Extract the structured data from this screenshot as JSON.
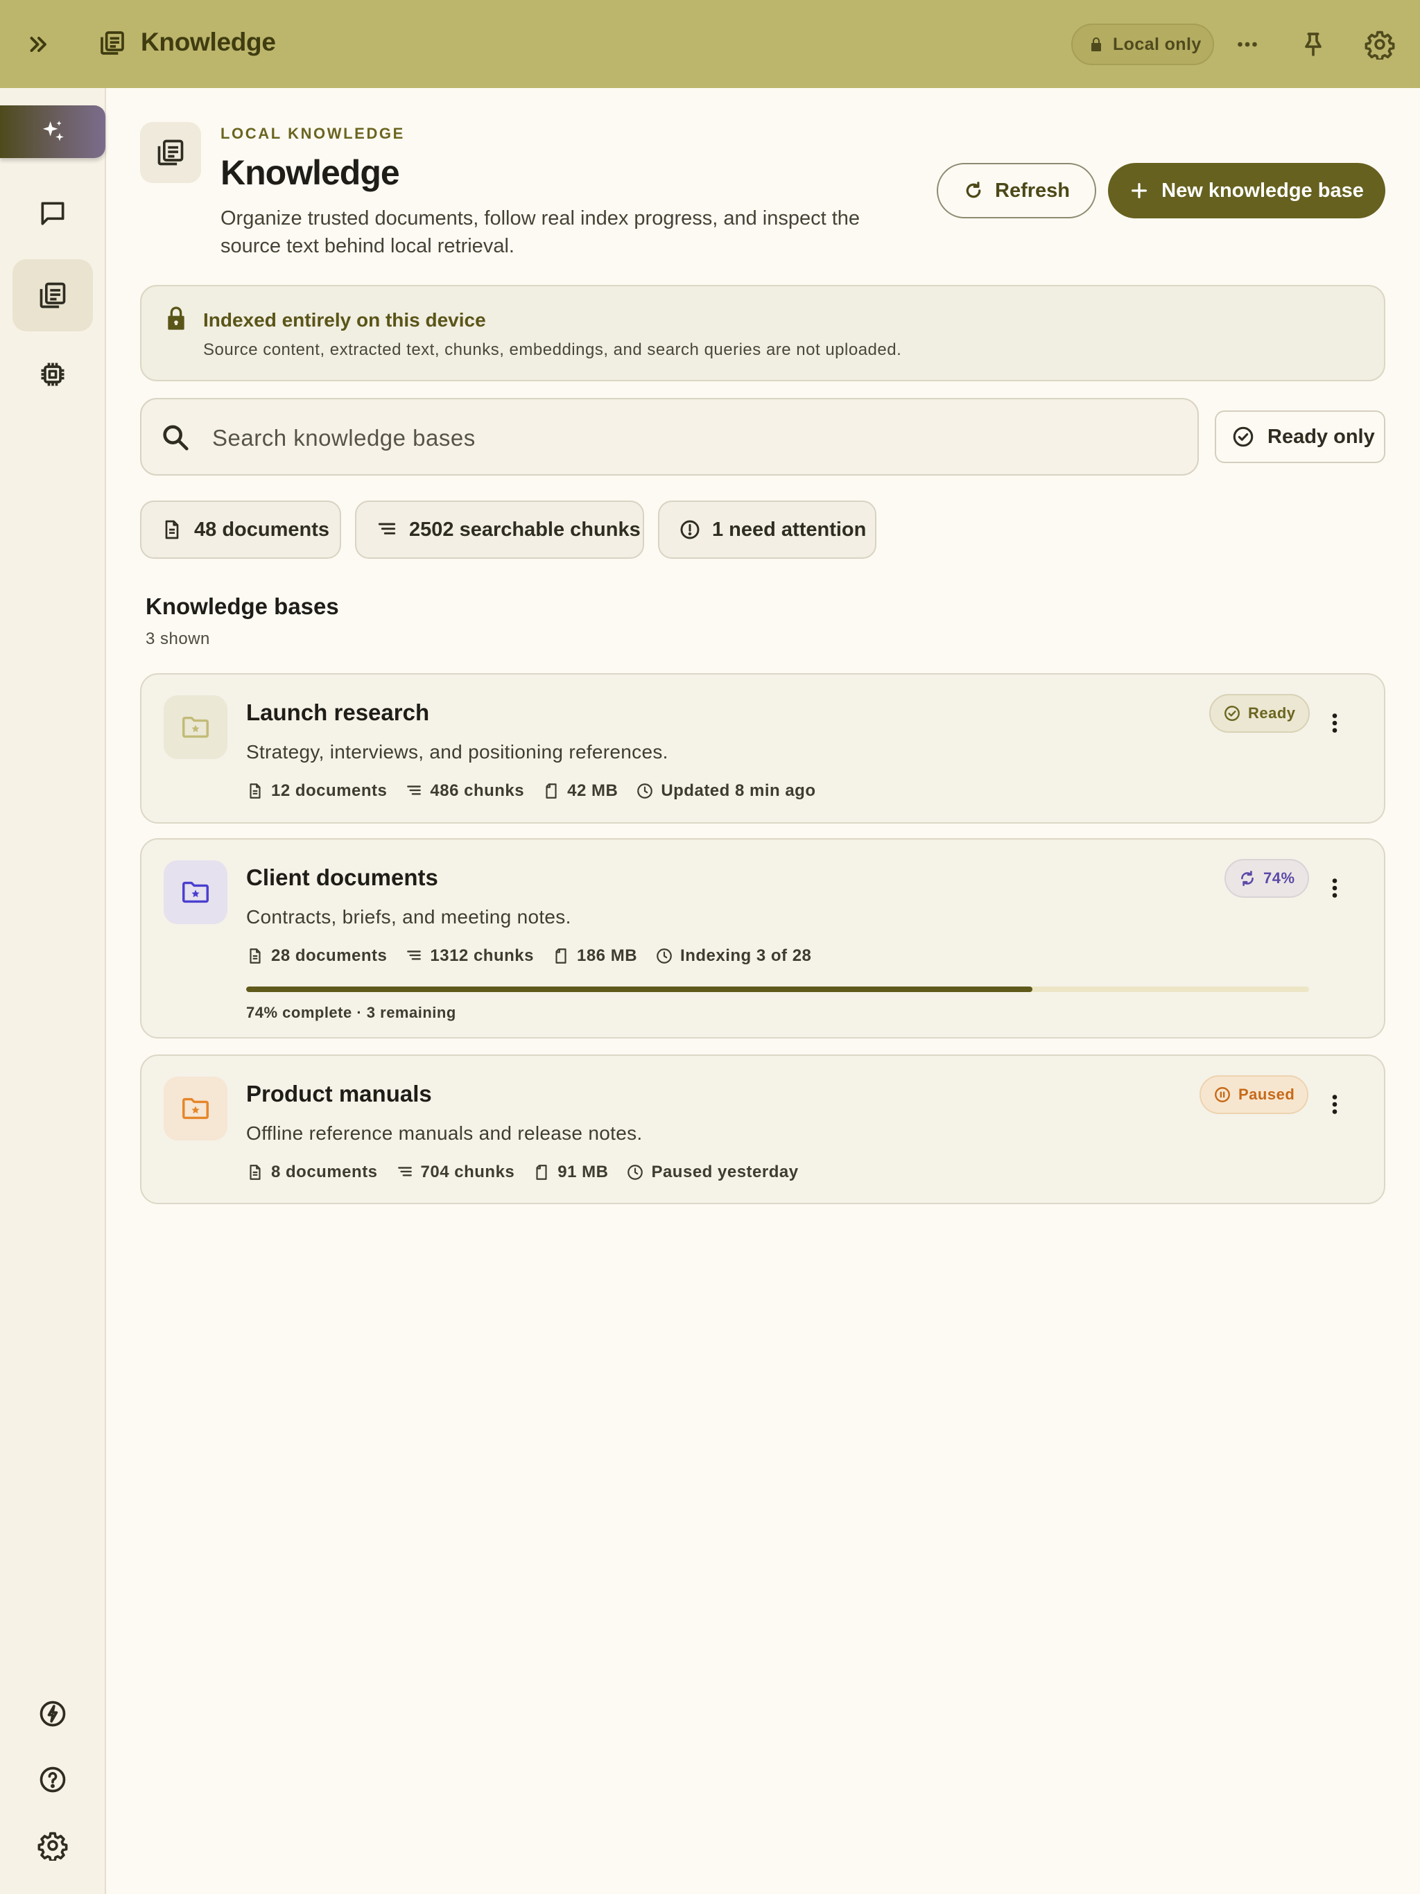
{
  "app": {
    "title": "Knowledge",
    "local_pill": "Local only"
  },
  "header": {
    "eyebrow": "LOCAL KNOWLEDGE",
    "title": "Knowledge",
    "description": "Organize trusted documents, follow real index progress, and inspect the source text behind local retrieval.",
    "refresh_label": "Refresh",
    "new_label": "New knowledge base"
  },
  "notice": {
    "title": "Indexed entirely on this device",
    "body": "Source content, extracted text, chunks, embeddings, and search queries are not uploaded."
  },
  "search": {
    "placeholder": "Search knowledge bases",
    "value": ""
  },
  "filter": {
    "ready_only_label": "Ready only"
  },
  "stats": {
    "documents": "48 documents",
    "chunks": "2502 searchable chunks",
    "attention": "1 need attention"
  },
  "section": {
    "title": "Knowledge bases",
    "count": "3 shown"
  },
  "colors": {
    "topbar": "#bcb56c",
    "accent": "#66611f",
    "ready": "#6b6520",
    "indexing": "#5b4aa8",
    "paused": "#c66a1a"
  },
  "icons": {
    "rail": [
      "sparkle-icon",
      "chat-icon",
      "library-icon",
      "chip-icon",
      "bolt-icon",
      "help-icon",
      "settings-icon"
    ],
    "topbar": [
      "expand-icon",
      "library-icon",
      "lock-icon",
      "more-icon",
      "pin-icon",
      "gear-icon"
    ]
  },
  "cards": [
    {
      "title": "Launch research",
      "description": "Strategy, interviews, and positioning references.",
      "badge": "Ready",
      "status": "ready",
      "documents": "12 documents",
      "chunks": "486 chunks",
      "size": "42 MB",
      "updated": "Updated 8 min ago"
    },
    {
      "title": "Client documents",
      "description": "Contracts, briefs, and meeting notes.",
      "badge": "74%",
      "status": "indexing",
      "documents": "28 documents",
      "chunks": "1312 chunks",
      "size": "186 MB",
      "updated": "Indexing 3 of 28",
      "progress": 0.74,
      "progress_text": "74% complete · 3 remaining"
    },
    {
      "title": "Product manuals",
      "description": "Offline reference manuals and release notes.",
      "badge": "Paused",
      "status": "paused",
      "documents": "8 documents",
      "chunks": "704 chunks",
      "size": "91 MB",
      "updated": "Paused yesterday"
    }
  ]
}
